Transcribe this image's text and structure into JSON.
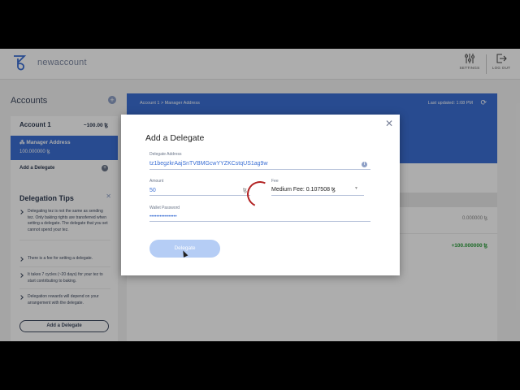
{
  "header": {
    "app_title": "newaccount",
    "settings_label": "SETTINGS",
    "logout_label": "LOG OUT"
  },
  "sidebar": {
    "title": "Accounts",
    "account": {
      "name": "Account 1",
      "balance": "~100.00 ꜩ",
      "manager_label": "Manager Address",
      "manager_balance": "100.000000 ꜩ",
      "add_delegate_link": "Add a Delegate"
    },
    "tips": {
      "title": "Delegation Tips",
      "items": [
        "Delegating tez is not the same as sending tez. Only baking rights are transferred when setting a delegate. The delegate that you set cannot spend your tez.",
        "There is a fee for setting a delegate.",
        "It takes 7 cycles (~20 days) for your tez to start contributing to baking.",
        "Delegation rewards will depend on your arrangement with the delegate."
      ],
      "button_label": "Add a Delegate"
    }
  },
  "main": {
    "breadcrumb": "Account 1 > Manager Address",
    "last_updated": "Last updated: 1:08 PM",
    "tx_amount_1": "0.000000 ꜩ",
    "tx_amount_2": "+100.000000 ꜩ"
  },
  "modal": {
    "title": "Add a Delegate",
    "delegate_address_label": "Delegate Address",
    "delegate_address_value": "tz1begzkrAajSnTVBMGcwYYZKCstqUS1ag9w",
    "amount_label": "Amount",
    "amount_value": "50",
    "amount_unit": "ꜩ",
    "fee_label": "Fee",
    "fee_value": "Medium Fee: 0.107508 ꜩ",
    "password_label": "Wallet Password",
    "password_value": "••••••••••••••••",
    "delegate_button": "Delegate"
  },
  "colors": {
    "accent": "#3b6fd4",
    "button_disabled": "#b5cdf5",
    "spinner": "#b22222",
    "positive": "#2a9d3a"
  }
}
